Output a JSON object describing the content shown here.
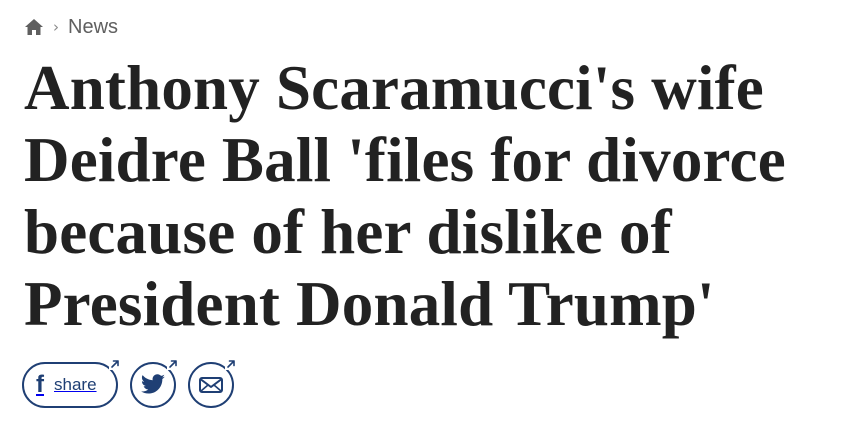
{
  "breadcrumb": {
    "home_icon": "home-icon",
    "separator": "›",
    "section": "News"
  },
  "headline": {
    "lines": [
      "Anthony Scaramucci's wife",
      "Deidre Ball 'files for divorce",
      "because of her dislike of",
      "President Donald Trump'"
    ]
  },
  "share": {
    "facebook_glyph": "f",
    "facebook_label": "share",
    "twitter_icon": "twitter-bird-icon",
    "email_icon": "envelope-icon",
    "external_icon": "external-arrow-icon",
    "accent_color": "#1f3f74"
  },
  "colors": {
    "text": "#222222",
    "breadcrumb": "#5f5f5f",
    "home_icon": "#5f5f5f",
    "background": "#ffffff"
  }
}
